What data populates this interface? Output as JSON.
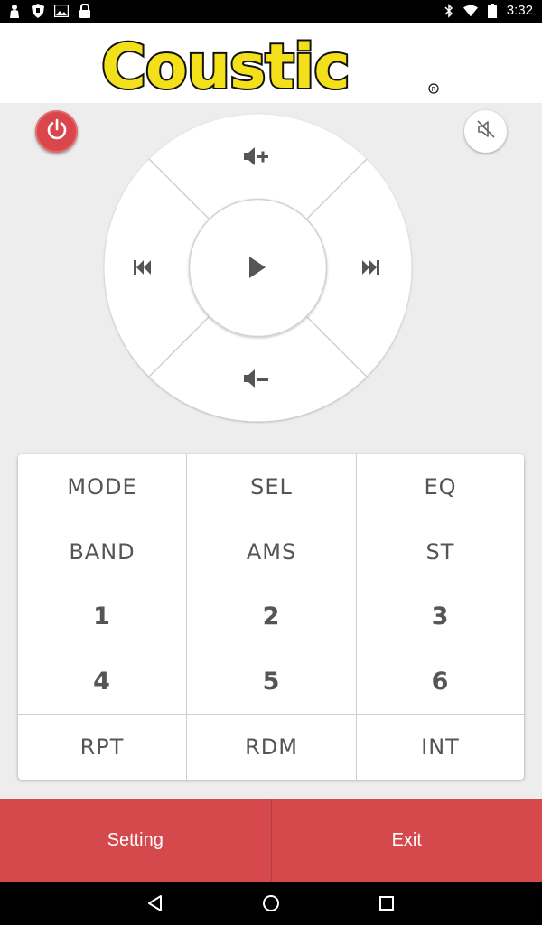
{
  "status_bar": {
    "time": "3:32",
    "left_icons": [
      "person-icon",
      "shield-icon",
      "image-icon",
      "lock-icon"
    ],
    "right_icons": [
      "bluetooth-icon",
      "wifi-icon",
      "battery-icon"
    ]
  },
  "header": {
    "logo_text": "Coustic",
    "registered_mark": "®"
  },
  "remote": {
    "power_icon": "power-icon",
    "mute_icon": "mute-icon",
    "dpad": {
      "up": "volume-up-icon",
      "down": "volume-down-icon",
      "left": "previous-track-icon",
      "right": "next-track-icon",
      "center": "play-icon"
    }
  },
  "keypad": {
    "keys": [
      [
        "MODE",
        "SEL",
        "EQ"
      ],
      [
        "BAND",
        "AMS",
        "ST"
      ],
      [
        "1",
        "2",
        "3"
      ],
      [
        "4",
        "5",
        "6"
      ],
      [
        "RPT",
        "RDM",
        "INT"
      ]
    ]
  },
  "bottom": {
    "setting_label": "Setting",
    "exit_label": "Exit"
  },
  "colors": {
    "accent": "#d5484b",
    "logo_yellow": "#f3e01b",
    "background": "#ededed"
  },
  "nav": {
    "icons": [
      "back-icon",
      "home-icon",
      "recents-icon"
    ]
  }
}
